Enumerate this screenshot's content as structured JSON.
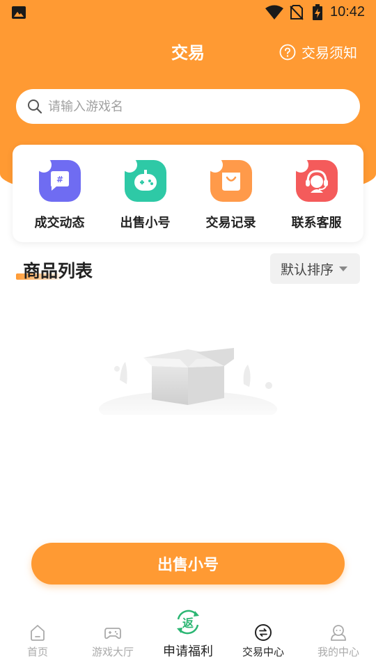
{
  "status_bar": {
    "time": "10:42"
  },
  "header": {
    "title": "交易",
    "notice_label": "交易须知"
  },
  "search": {
    "placeholder": "请输入游戏名",
    "value": ""
  },
  "actions": [
    {
      "label": "成交动态",
      "icon": "chat-hash-icon",
      "color": "#6f6cf2"
    },
    {
      "label": "出售小号",
      "icon": "robot-icon",
      "color": "#2ec9a6"
    },
    {
      "label": "交易记录",
      "icon": "shopping-bag-icon",
      "color": "#ff9a4a"
    },
    {
      "label": "联系客服",
      "icon": "headset-icon",
      "color": "#f45b5b"
    }
  ],
  "product_section": {
    "title": "商品列表",
    "sort_label": "默认排序"
  },
  "sell_button": {
    "label": "出售小号"
  },
  "bottom_nav": [
    {
      "label": "首页",
      "icon": "home-icon"
    },
    {
      "label": "游戏大厅",
      "icon": "gamepad-icon"
    },
    {
      "label": "申请福利",
      "icon": "rebate-icon",
      "badge_text": "返"
    },
    {
      "label": "交易中心",
      "icon": "exchange-icon"
    },
    {
      "label": "我的中心",
      "icon": "user-icon"
    }
  ],
  "colors": {
    "brand": "#ff9a33",
    "promo_green": "#2bb673"
  }
}
